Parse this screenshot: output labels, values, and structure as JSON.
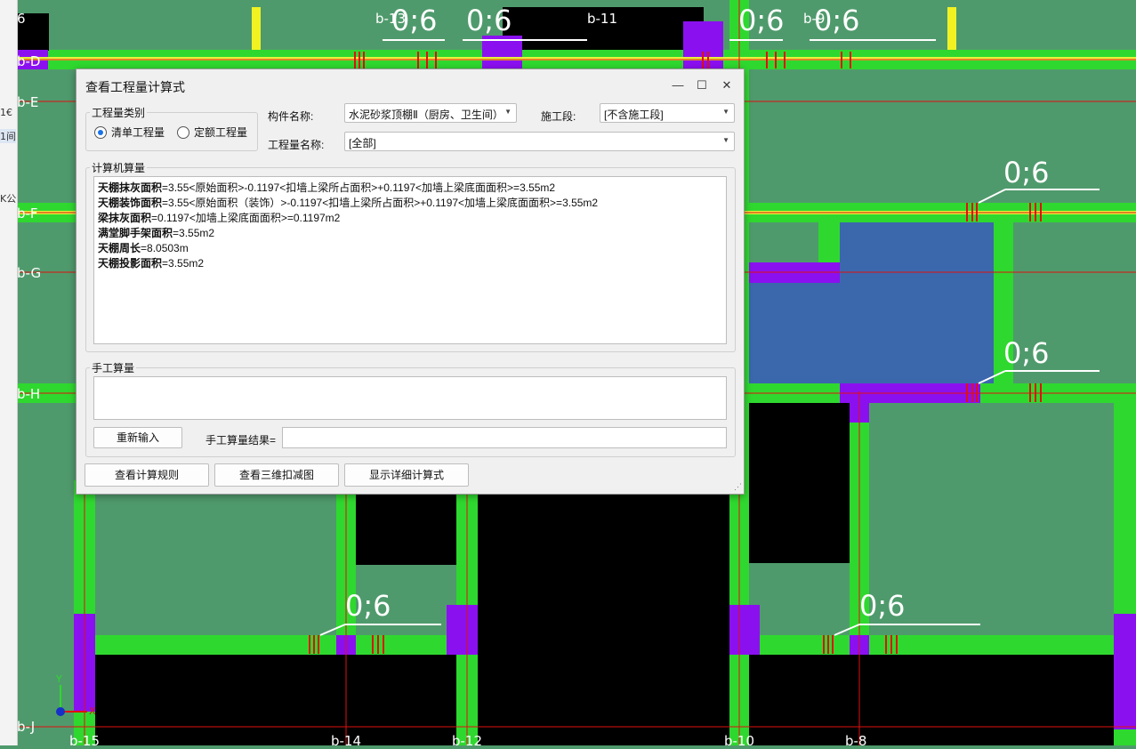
{
  "canvas": {
    "top_grid_labels": [
      "6",
      "b-13",
      "b-11",
      "b-9"
    ],
    "side_grid_labels": [
      "b-D",
      "b-E",
      "b-F",
      "b-G",
      "b-H",
      "b-J"
    ],
    "bottom_grid_labels": [
      "b-15",
      "b-14",
      "b-12",
      "b-10",
      "b-8"
    ],
    "dimension_labels": [
      "0;6",
      "0;6",
      "0;6",
      "0;6",
      "0;6",
      "0;6",
      "0;6",
      "0;6"
    ],
    "axis_x": "X",
    "axis_y": "Y",
    "colors": {
      "background": "#4f9a6c",
      "green": "#2fd82f",
      "purple": "#8b10f0",
      "blue": "#3b67ad",
      "red": "#e01010",
      "black": "#000000",
      "yellow": "#f2f222"
    }
  },
  "left_strip": {
    "items": [
      "1€",
      "1间",
      "K公"
    ]
  },
  "dialog": {
    "title": "查看工程量计算式",
    "window_buttons": {
      "minimize": "—",
      "maximize": "☐",
      "close": "✕"
    },
    "quantity_type": {
      "legend": "工程量类别",
      "options": [
        {
          "label": "清单工程量",
          "selected": true
        },
        {
          "label": "定额工程量",
          "selected": false
        }
      ]
    },
    "component_name": {
      "label": "构件名称:",
      "value": "水泥砂浆顶棚Ⅱ（厨房、卫生间）"
    },
    "construction_stage": {
      "label": "施工段:",
      "value": "[不含施工段]"
    },
    "quantity_name": {
      "label": "工程量名称:",
      "value": "[全部]"
    },
    "computer_calc": {
      "legend": "计算机算量",
      "lines": [
        {
          "name": "天棚抹灰面积",
          "expr": "=3.55<原始面积>-0.1197<扣墙上梁所占面积>+0.1197<加墙上梁底面面积>=3.55m2"
        },
        {
          "name": "天棚装饰面积",
          "expr": "=3.55<原始面积（装饰）>-0.1197<扣墙上梁所占面积>+0.1197<加墙上梁底面面积>=3.55m2"
        },
        {
          "name": "梁抹灰面积",
          "expr": "=0.1197<加墙上梁底面面积>=0.1197m2"
        },
        {
          "name": "满堂脚手架面积",
          "expr": "=3.55m2"
        },
        {
          "name": "天棚周长",
          "expr": "=8.0503m"
        },
        {
          "name": "天棚投影面积",
          "expr": "=3.55m2"
        }
      ]
    },
    "manual_calc": {
      "legend": "手工算量",
      "reenter_button": "重新输入",
      "result_label": "手工算量结果=",
      "result_value": ""
    },
    "buttons": {
      "view_rules": "查看计算规则",
      "view_3d": "查看三维扣减图",
      "show_detail": "显示详细计算式"
    }
  }
}
